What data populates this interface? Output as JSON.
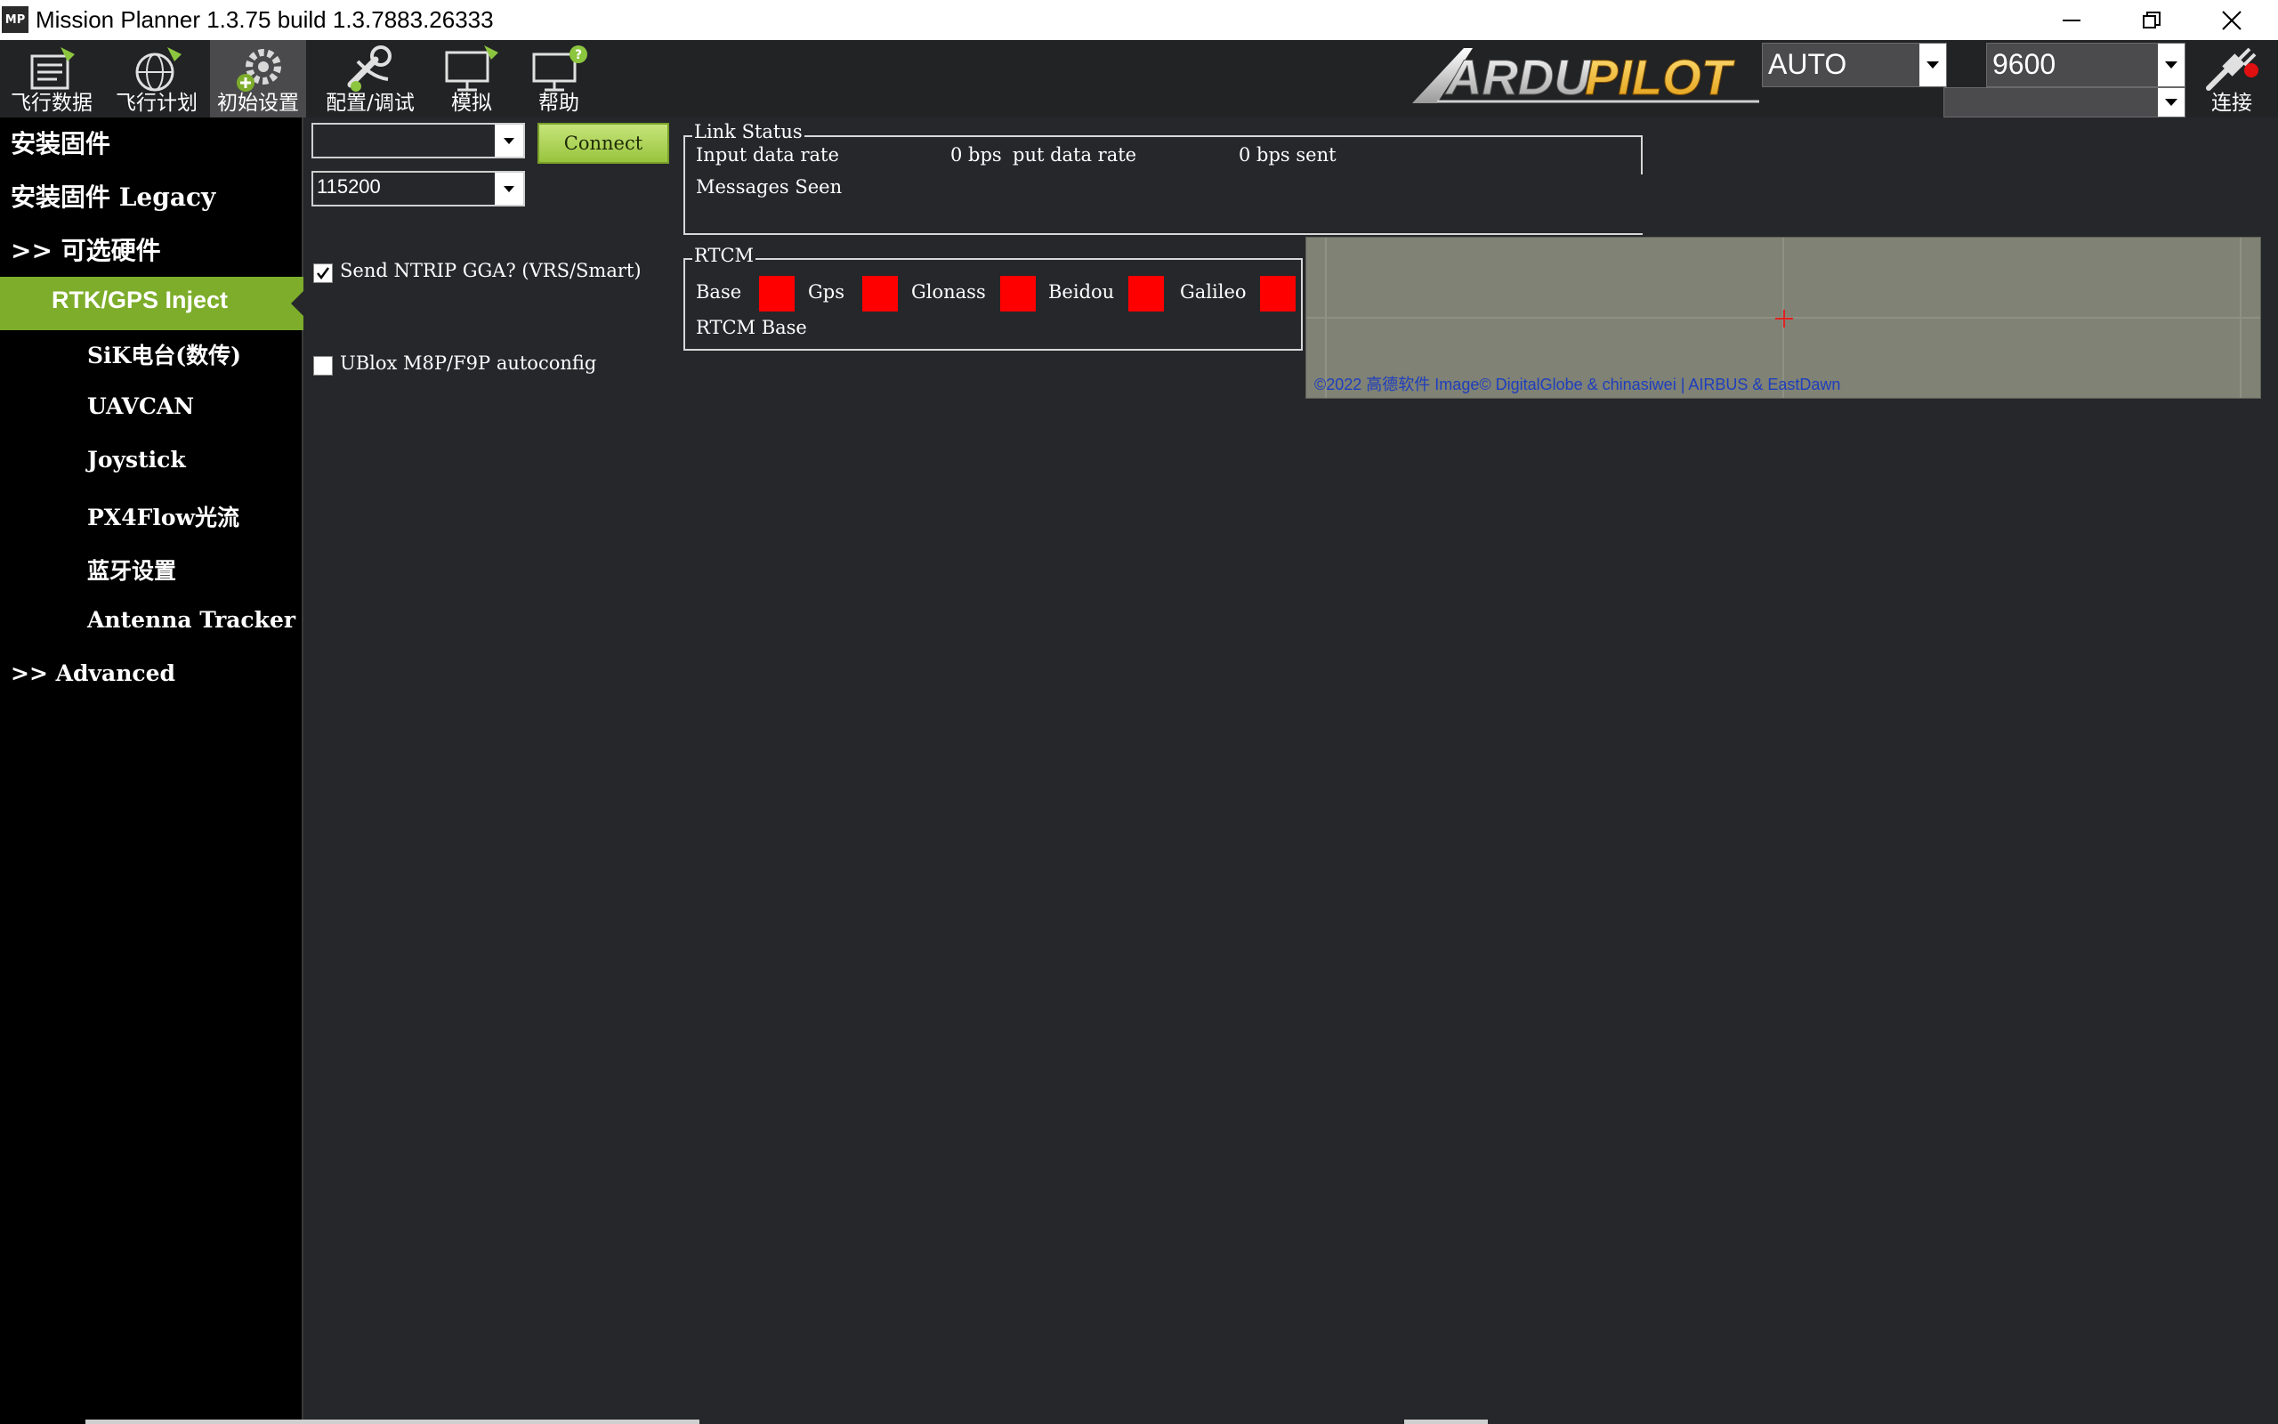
{
  "window": {
    "title": "Mission Planner 1.3.75 build 1.3.7883.26333",
    "icon_text": "MP"
  },
  "toolbar": {
    "buttons": [
      {
        "label": "飞行数据",
        "icon": "flight-data-icon"
      },
      {
        "label": "飞行计划",
        "icon": "flight-plan-icon"
      },
      {
        "label": "初始设置",
        "icon": "initial-setup-icon"
      },
      {
        "label": "配置/调试",
        "icon": "config-tuning-icon"
      },
      {
        "label": "模拟",
        "icon": "simulation-icon"
      },
      {
        "label": "帮助",
        "icon": "help-icon"
      }
    ],
    "logo_text": "ARDUPILOT",
    "mode_value": "AUTO",
    "baud_value": "9600",
    "port_value": "",
    "connect_label": "连接"
  },
  "sidebar": {
    "items": [
      {
        "label": "安装固件"
      },
      {
        "label": "安装固件 Legacy"
      },
      {
        "label": ">> 可选硬件"
      },
      {
        "label": "RTK/GPS Inject"
      },
      {
        "label": "SiK电台(数传)"
      },
      {
        "label": "UAVCAN"
      },
      {
        "label": "Joystick"
      },
      {
        "label": "PX4Flow光流"
      },
      {
        "label": "蓝牙设置"
      },
      {
        "label": "Antenna Tracker"
      },
      {
        "label": ">> Advanced"
      }
    ]
  },
  "rtk": {
    "port_value": "",
    "baud_value": "115200",
    "connect_label": "Connect",
    "send_ntrip_label": "Send NTRIP GGA? (VRS/Smart)",
    "send_ntrip_checked": true,
    "ublox_label": "UBlox M8P/F9P autoconfig",
    "ublox_checked": false
  },
  "link_status": {
    "title": "Link Status",
    "input_rate_label": "Input data rate",
    "input_rate_value": "0 bps",
    "output_rate_label": "put data rate",
    "output_rate_value": "0 bps sent",
    "messages_label": "Messages Seen"
  },
  "rtcm": {
    "title": "RTCM",
    "indicators": [
      "Base",
      "Gps",
      "Glonass",
      "Beidou",
      "Galileo"
    ],
    "indicator_color": "#ff0000",
    "rtcm_base_label": "RTCM Base"
  },
  "map": {
    "copyright": "©2022 高德软件 Image© DigitalGlobe & chinasiwei | AIRBUS & EastDawn"
  },
  "colors": {
    "accent": "#7dad2b",
    "background": "#26272b",
    "sidebar": "#000000"
  }
}
